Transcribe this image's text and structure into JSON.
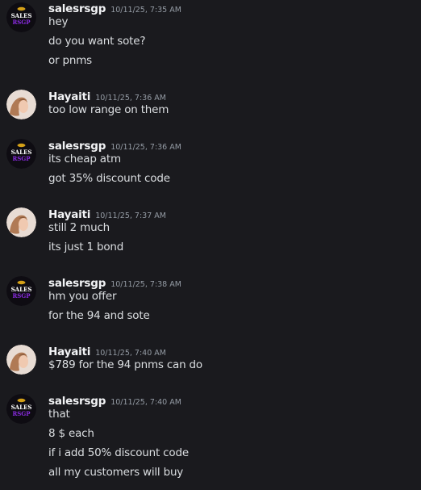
{
  "messages": [
    {
      "author": "salesrsgp",
      "timestamp": "10/11/25, 7:35 AM",
      "avatar": "sales-rsgp-logo",
      "avatar_text": [
        "SALES",
        "RSGP"
      ],
      "lines": [
        "hey",
        "do you want sote?",
        "or pnms"
      ]
    },
    {
      "author": "Hayaiti",
      "timestamp": "10/11/25, 7:36 AM",
      "avatar": "profile-photo",
      "lines": [
        "too low range on them"
      ]
    },
    {
      "author": "salesrsgp",
      "timestamp": "10/11/25, 7:36 AM",
      "avatar": "sales-rsgp-logo",
      "avatar_text": [
        "SALES",
        "RSGP"
      ],
      "lines": [
        "its cheap atm",
        "got 35% discount code"
      ]
    },
    {
      "author": "Hayaiti",
      "timestamp": "10/11/25, 7:37 AM",
      "avatar": "profile-photo",
      "lines": [
        "still 2 much",
        "its just 1 bond"
      ]
    },
    {
      "author": "salesrsgp",
      "timestamp": "10/11/25, 7:38 AM",
      "avatar": "sales-rsgp-logo",
      "avatar_text": [
        "SALES",
        "RSGP"
      ],
      "lines": [
        "hm you offer",
        "for the 94 and sote"
      ]
    },
    {
      "author": "Hayaiti",
      "timestamp": "10/11/25, 7:40 AM",
      "avatar": "profile-photo",
      "lines": [
        "$789 for the 94 pnms can do"
      ]
    },
    {
      "author": "salesrsgp",
      "timestamp": "10/11/25, 7:40 AM",
      "avatar": "sales-rsgp-logo",
      "avatar_text": [
        "SALES",
        "RSGP"
      ],
      "lines": [
        "that",
        "8 $ each",
        "if i add 50% discount code",
        "all my customers will buy"
      ]
    }
  ]
}
